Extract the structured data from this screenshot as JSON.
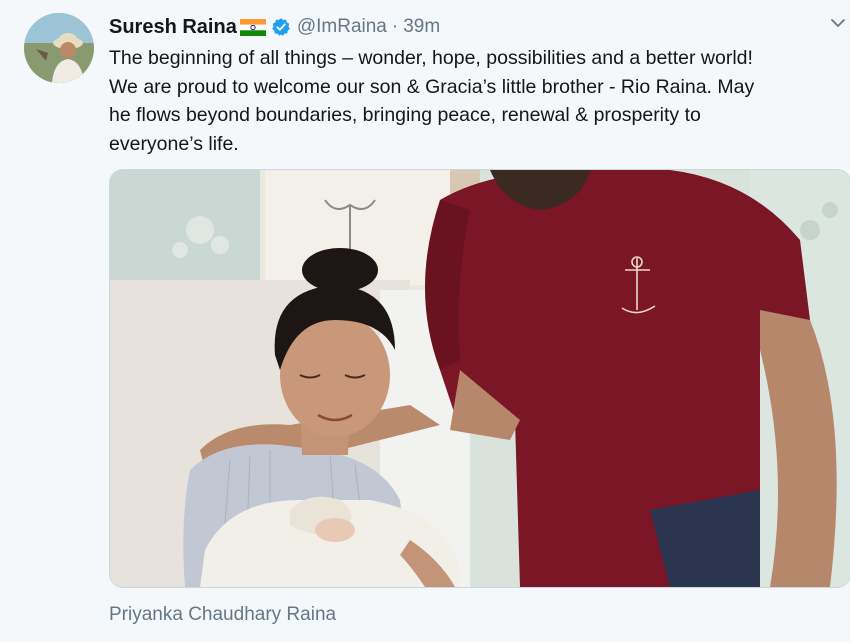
{
  "tweet": {
    "author_name": "Suresh Raina",
    "author_flag": "india-flag",
    "verified_icon": "verified-badge-icon",
    "handle": "@ImRaina",
    "separator": "·",
    "time": "39m",
    "text_lines": [
      "The beginning of all things – wonder, hope, possibilities and a better world!",
      "We are proud to welcome our son & Gracia’s little brother - Rio Raina. May",
      "he flows beyond boundaries, bringing peace, renewal & prosperity to",
      "everyone’s life."
    ],
    "media_caption": "Priyanka Chaudhary Raina",
    "more_icon": "chevron-down-icon"
  },
  "colors": {
    "background": "#f5f8fa",
    "text": "#14171a",
    "muted": "#657786",
    "verified_blue": "#1da1f2",
    "shirt_maroon": "#7a1626"
  }
}
